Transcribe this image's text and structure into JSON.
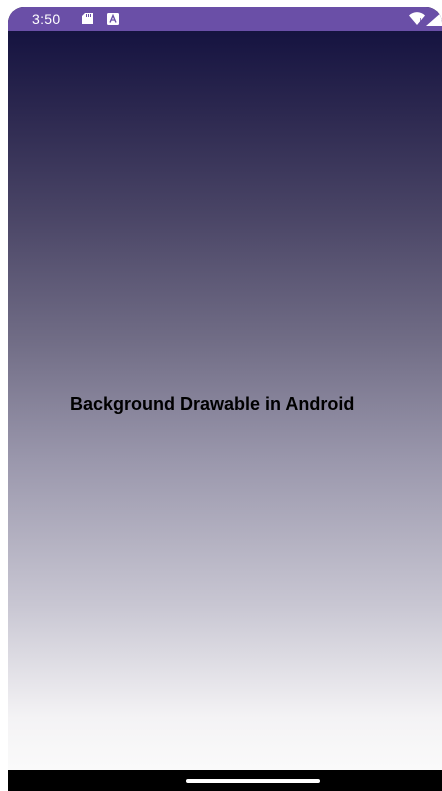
{
  "status_bar": {
    "time": "3:50",
    "background_color": "#6a4fa7",
    "icons": [
      "sd-card-icon",
      "a-notification-icon",
      "wifi-icon",
      "signal-icon"
    ]
  },
  "main": {
    "headline": "Background Drawable in Android",
    "gradient_colors": [
      "#151340",
      "#fafafa"
    ]
  },
  "nav_bar": {
    "background_color": "#000000",
    "handle_icon": "home-gesture-handle"
  }
}
